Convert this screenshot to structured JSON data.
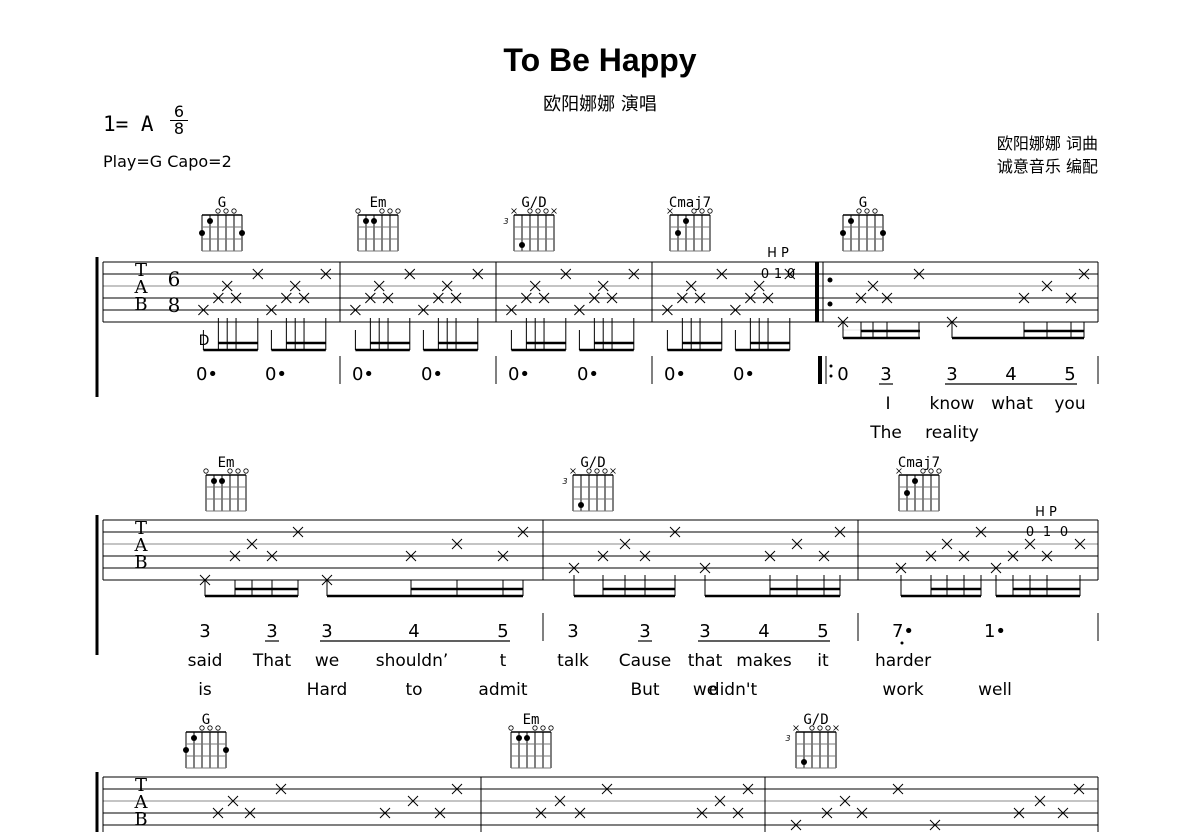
{
  "header": {
    "title": "To Be Happy",
    "performer": "欧阳娜娜 演唱",
    "key": "1= A",
    "time_signature": {
      "top": "6",
      "bottom": "8"
    },
    "capo": "Play=G Capo=2",
    "credits": [
      "欧阳娜娜 词曲",
      "诚意音乐 编配"
    ]
  },
  "tab_labels": [
    "T",
    "A",
    "B"
  ],
  "systems": [
    {
      "chords": [
        {
          "name": "G",
          "measure": 0
        },
        {
          "name": "Em",
          "measure": 1
        },
        {
          "name": "G/D",
          "measure": 2,
          "fret_label": "3"
        },
        {
          "name": "Cmaj7",
          "measure": 3
        },
        {
          "name": "G",
          "measure": 4
        }
      ],
      "technique_labels": [
        "H P",
        "H P"
      ],
      "tab_fret_numbers": [
        "0",
        "1",
        "0"
      ],
      "measures": [
        {
          "notation": [
            "0•",
            "0•"
          ]
        },
        {
          "notation": [
            "0•",
            "0•"
          ]
        },
        {
          "notation": [
            "0•",
            "0•"
          ]
        },
        {
          "notation": [
            "0•",
            "0•"
          ]
        },
        {
          "repeat_start": true,
          "notation": [
            "0",
            "3",
            "3",
            "4",
            "5"
          ],
          "lyrics1": [
            "",
            "I",
            "know",
            "what",
            "you"
          ],
          "lyrics2": [
            "",
            "The",
            "reality",
            "",
            ""
          ]
        }
      ]
    },
    {
      "chords": [
        {
          "name": "Em",
          "measure": 0
        },
        {
          "name": "G/D",
          "measure": 1,
          "fret_label": "3"
        },
        {
          "name": "Cmaj7",
          "measure": 2
        }
      ],
      "technique_label": "H P",
      "tab_fret_numbers": [
        "0",
        "1",
        "0"
      ],
      "measures": [
        {
          "notation": [
            "3",
            "3",
            "3",
            "4",
            "5"
          ],
          "lyrics1": [
            "said",
            "That",
            "we",
            "shouldn’",
            "t"
          ],
          "lyrics2": [
            "is",
            "",
            "Hard",
            "to",
            "admit"
          ]
        },
        {
          "notation": [
            "3",
            "3",
            "3",
            "4",
            "5"
          ],
          "lyrics1": [
            "talk",
            "Cause",
            "that",
            "makes",
            "it"
          ],
          "lyrics2": [
            "",
            "But",
            "we",
            "didn't",
            ""
          ]
        },
        {
          "notation": [
            "7•",
            "1•"
          ],
          "lyrics1": [
            "harder",
            ""
          ],
          "lyrics2": [
            "work",
            "well"
          ]
        }
      ]
    },
    {
      "chords": [
        {
          "name": "G",
          "measure": 0
        },
        {
          "name": "Em",
          "measure": 1
        },
        {
          "name": "G/D",
          "measure": 2,
          "fret_label": "3"
        }
      ]
    }
  ]
}
